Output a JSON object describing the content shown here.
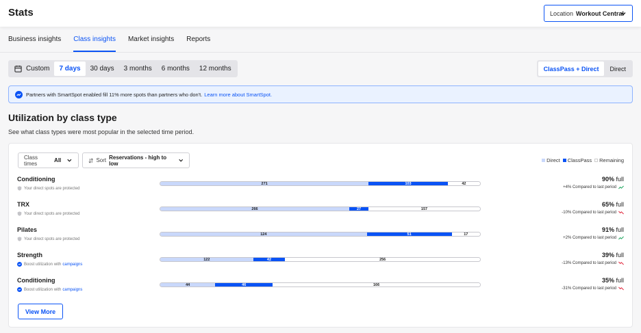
{
  "header": {
    "title": "Stats",
    "location_label": "Location",
    "location_value": "Workout Central"
  },
  "tabs": [
    "Business insights",
    "Class insights",
    "Market insights",
    "Reports"
  ],
  "active_tab": "Class insights",
  "period": {
    "options": [
      "Custom",
      "7 days",
      "30 days",
      "3 months",
      "6 months",
      "12 months"
    ],
    "selected": "7 days"
  },
  "source": {
    "options": [
      "ClassPass + Direct",
      "Direct"
    ],
    "selected": "ClassPass + Direct"
  },
  "banner": {
    "text": "Partners with SmartSpot enabled fill 11% more spots than partners who don't.",
    "link": "Learn more about SmartSpot."
  },
  "section": {
    "title": "Utilization by class type",
    "subtitle": "See what class types were most popular in the selected time period."
  },
  "filters": {
    "class_times_label": "Class times",
    "class_times_value": "All",
    "sort_label": "Sort",
    "sort_value": "Reservations - high to low"
  },
  "legend": {
    "direct": "Direct",
    "classpass": "ClassPass",
    "remaining": "Remaining"
  },
  "colors": {
    "accent": "#0a53f5",
    "direct": "#c9d8fb",
    "classpass": "#0a53f5",
    "trend_up": "#1aa35a",
    "trend_down": "#e0243a"
  },
  "rows": [
    {
      "name": "Conditioning",
      "note": "Your direct spots are protected",
      "note_link": "",
      "note_icon": "shield-icon",
      "direct": 271,
      "classpass": 103,
      "remaining": 42,
      "pct": "90%",
      "full": "full",
      "compare": "+4% Compared to last period",
      "trend": "up"
    },
    {
      "name": "TRX",
      "note": "Your direct spots are protected",
      "note_link": "",
      "note_icon": "shield-icon",
      "direct": 266,
      "classpass": 27,
      "remaining": 157,
      "pct": "65%",
      "full": "full",
      "compare": "-10% Compared to last period",
      "trend": "down"
    },
    {
      "name": "Pilates",
      "note": "Your direct spots are protected",
      "note_link": "",
      "note_icon": "shield-icon",
      "direct": 124,
      "classpass": 51,
      "remaining": 17,
      "pct": "91%",
      "full": "full",
      "compare": "+2% Compared to last period",
      "trend": "up"
    },
    {
      "name": "Strength",
      "note": "Boost utilization with",
      "note_link": "campaigns",
      "note_icon": "boost-icon",
      "direct": 122,
      "classpass": 42,
      "remaining": 256,
      "pct": "39%",
      "full": "full",
      "compare": "-13% Compared to last period",
      "trend": "down"
    },
    {
      "name": "Conditioning",
      "note": "Boost utilization with",
      "note_link": "campaigns",
      "note_icon": "boost-icon",
      "direct": 44,
      "classpass": 46,
      "remaining": 166,
      "pct": "35%",
      "full": "full",
      "compare": "-31% Compared to last period",
      "trend": "down"
    }
  ],
  "view_more": "View More"
}
